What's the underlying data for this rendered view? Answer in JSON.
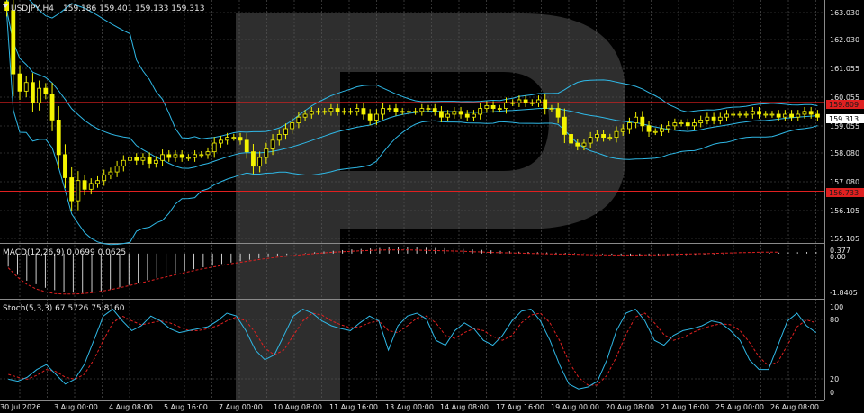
{
  "colors": {
    "background": "#000000",
    "grid": "#5a5a5a",
    "candle_up": "#f4f400",
    "candle_down": "#f4f400",
    "bollinger": "#2fb8e6",
    "hline": "#e02020",
    "macd_hist": "#cfcfcf",
    "macd_signal": "#e02020",
    "stoch_main": "#2fb8e6",
    "stoch_signal": "#e02020",
    "text": "#e6e6e6",
    "watermark": "#3a3a3a"
  },
  "header": {
    "menu_icon": "triangle-down-icon",
    "symbol": "USDJPY,H4",
    "quotes": "159.186 159.401 159.133 159.313"
  },
  "price_axis": {
    "labels": [
      "163.030",
      "162.030",
      "161.055",
      "160.055",
      "159.055",
      "158.080",
      "157.080",
      "156.105",
      "155.105"
    ],
    "current_price": "159.313",
    "upper_level": "159.809",
    "lower_level": "156.733"
  },
  "macd": {
    "title": "MACD(12,26,9) 0.0699 0.0625",
    "labels": [
      "0.377",
      "0.00",
      "-1.8405"
    ]
  },
  "stoch": {
    "title": "Stoch(5,3,3) 67.5726 75.8160",
    "labels": [
      "100",
      "80",
      "20",
      "0"
    ]
  },
  "time_axis": {
    "labels": [
      "30 Jul 2026",
      "3 Aug 00:00",
      "4 Aug 08:00",
      "5 Aug 16:00",
      "7 Aug 00:00",
      "10 Aug 08:00",
      "11 Aug 16:00",
      "13 Aug 00:00",
      "14 Aug 08:00",
      "17 Aug 16:00",
      "19 Aug 00:00",
      "20 Aug 08:00",
      "21 Aug 16:00",
      "25 Aug 00:00",
      "26 Aug 08:00"
    ]
  },
  "chart_data": {
    "type": "candlestick",
    "ylim": [
      155.0,
      163.3
    ],
    "levels": [
      159.809,
      156.733
    ],
    "closes": [
      163.0,
      160.8,
      160.2,
      160.5,
      159.8,
      160.3,
      160.1,
      159.2,
      158.0,
      157.2,
      156.4,
      157.1,
      156.8,
      157.0,
      157.1,
      157.3,
      157.4,
      157.6,
      157.8,
      157.9,
      157.8,
      157.9,
      157.7,
      157.8,
      158.0,
      157.9,
      158.0,
      157.9,
      157.9,
      158.0,
      158.0,
      158.1,
      158.4,
      158.5,
      158.6,
      158.6,
      158.5,
      158.1,
      157.6,
      157.9,
      158.2,
      158.5,
      158.7,
      158.9,
      159.1,
      159.3,
      159.4,
      159.5,
      159.5,
      159.5,
      159.6,
      159.5,
      159.5,
      159.5,
      159.6,
      159.4,
      159.2,
      159.4,
      159.6,
      159.6,
      159.5,
      159.5,
      159.5,
      159.5,
      159.6,
      159.6,
      159.5,
      159.3,
      159.4,
      159.5,
      159.4,
      159.3,
      159.4,
      159.6,
      159.7,
      159.6,
      159.6,
      159.8,
      159.8,
      159.9,
      159.8,
      159.8,
      159.9,
      159.6,
      159.6,
      159.3,
      158.7,
      158.4,
      158.3,
      158.4,
      158.6,
      158.7,
      158.6,
      158.6,
      158.8,
      158.9,
      159.1,
      159.3,
      159.0,
      158.8,
      158.8,
      158.9,
      159.0,
      159.1,
      159.1,
      159.0,
      159.1,
      159.2,
      159.3,
      159.2,
      159.3,
      159.4,
      159.4,
      159.4,
      159.4,
      159.5,
      159.4,
      159.4,
      159.4,
      159.3,
      159.4,
      159.3,
      159.4,
      159.5,
      159.4,
      159.3
    ],
    "macd_hist": [
      -0.55,
      -0.9,
      -1.15,
      -1.3,
      -1.45,
      -1.55,
      -1.62,
      -1.66,
      -1.68,
      -1.65,
      -1.6,
      -1.52,
      -1.43,
      -1.33,
      -1.23,
      -1.13,
      -1.03,
      -0.93,
      -0.83,
      -0.74,
      -0.66,
      -0.58,
      -0.51,
      -0.44,
      -0.38,
      -0.32,
      -0.26,
      -0.2,
      -0.15,
      -0.1,
      -0.06,
      -0.02,
      0.02,
      0.06,
      0.09,
      0.12,
      0.15,
      0.18,
      0.2,
      0.22,
      0.24,
      0.26,
      0.27,
      0.27,
      0.26,
      0.25,
      0.24,
      0.23,
      0.22,
      0.2,
      0.18,
      0.16,
      0.14,
      0.12,
      0.1,
      0.08,
      0.07,
      0.06,
      0.05,
      0.04,
      0.03,
      0.02,
      0.01,
      -0.01,
      -0.03,
      -0.05,
      -0.07,
      -0.08,
      -0.09,
      -0.09,
      -0.09,
      -0.08,
      -0.07,
      -0.06,
      -0.05,
      -0.04,
      -0.03,
      -0.02,
      -0.01,
      0.0,
      0.01,
      0.02,
      0.03,
      0.04,
      0.05,
      0.06,
      0.07,
      0.07
    ],
    "macd_signal": [
      -0.6,
      -1.0,
      -1.3,
      -1.5,
      -1.62,
      -1.7,
      -1.72,
      -1.72,
      -1.7,
      -1.66,
      -1.6,
      -1.53,
      -1.45,
      -1.36,
      -1.27,
      -1.18,
      -1.08,
      -0.99,
      -0.9,
      -0.81,
      -0.72,
      -0.64,
      -0.57,
      -0.5,
      -0.43,
      -0.37,
      -0.31,
      -0.25,
      -0.2,
      -0.15,
      -0.11,
      -0.07,
      -0.03,
      0.0,
      0.03,
      0.06,
      0.08,
      0.1,
      0.12,
      0.14,
      0.15,
      0.16,
      0.16,
      0.16,
      0.15,
      0.14,
      0.13,
      0.12,
      0.11,
      0.1,
      0.08,
      0.07,
      0.05,
      0.04,
      0.03,
      0.02,
      0.01,
      0.0,
      -0.01,
      -0.02,
      -0.02,
      -0.03,
      -0.04,
      -0.05,
      -0.05,
      -0.06,
      -0.06,
      -0.06,
      -0.06,
      -0.05,
      -0.05,
      -0.04,
      -0.03,
      -0.02,
      -0.01,
      0.0,
      0.01,
      0.02,
      0.03,
      0.04,
      0.05,
      0.06,
      0.06,
      0.06
    ],
    "stoch_main": [
      20,
      18,
      22,
      30,
      35,
      25,
      15,
      20,
      35,
      60,
      85,
      92,
      80,
      70,
      75,
      85,
      80,
      72,
      68,
      70,
      72,
      74,
      80,
      88,
      85,
      70,
      50,
      40,
      45,
      65,
      85,
      92,
      88,
      80,
      75,
      72,
      70,
      78,
      85,
      80,
      50,
      75,
      85,
      88,
      82,
      60,
      55,
      70,
      78,
      72,
      60,
      55,
      65,
      80,
      90,
      92,
      80,
      60,
      35,
      15,
      10,
      12,
      18,
      40,
      70,
      88,
      92,
      80,
      60,
      55,
      65,
      70,
      72,
      75,
      80,
      78,
      70,
      60,
      40,
      30,
      30,
      55,
      80,
      88,
      75,
      68
    ],
    "stoch_signal": [
      25,
      22,
      20,
      24,
      30,
      28,
      22,
      20,
      25,
      40,
      60,
      78,
      85,
      80,
      76,
      78,
      80,
      78,
      74,
      70,
      70,
      72,
      75,
      80,
      84,
      80,
      68,
      52,
      45,
      50,
      65,
      80,
      88,
      86,
      80,
      76,
      73,
      74,
      78,
      80,
      70,
      68,
      75,
      83,
      85,
      78,
      65,
      62,
      68,
      72,
      70,
      64,
      60,
      65,
      78,
      86,
      88,
      78,
      60,
      38,
      22,
      14,
      14,
      24,
      43,
      66,
      84,
      88,
      78,
      66,
      60,
      63,
      68,
      72,
      75,
      77,
      76,
      70,
      58,
      43,
      34,
      38,
      55,
      74,
      81,
      78
    ]
  }
}
